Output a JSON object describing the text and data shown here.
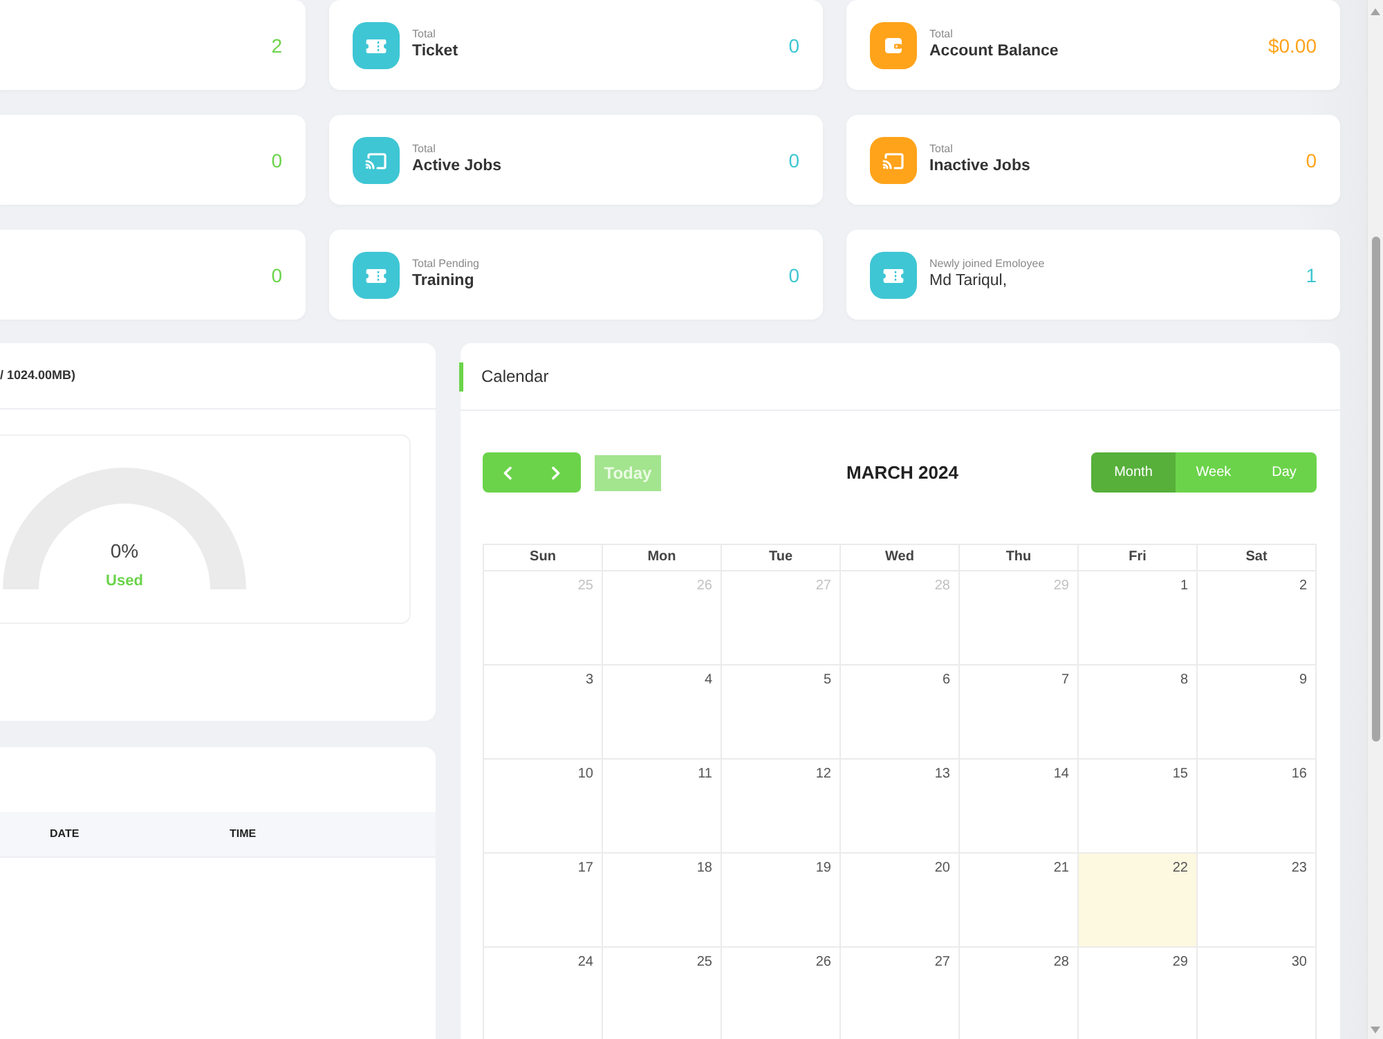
{
  "stats": [
    {
      "value": "2",
      "color": "#6bd34a"
    },
    {
      "kind": "ticket",
      "caption": "Total",
      "label": "Ticket",
      "label_bold": true,
      "value": "0",
      "color": "#3ec6d4"
    },
    {
      "kind": "wallet",
      "caption": "Total",
      "label": "Account Balance",
      "label_bold": true,
      "value": "$0.00",
      "color": "#ffa31a"
    },
    {
      "value": "0",
      "color": "#6bd34a"
    },
    {
      "kind": "cast",
      "caption": "Total",
      "label": "Active Jobs",
      "label_bold": true,
      "value": "0",
      "color": "#3ec6d4"
    },
    {
      "kind": "cast",
      "caption": "Total",
      "label": "Inactive Jobs",
      "label_bold": true,
      "value": "0",
      "color": "#ffa31a"
    },
    {
      "value": "0",
      "color": "#6bd34a"
    },
    {
      "kind": "ticket",
      "caption": "Total Pending",
      "label": "Training",
      "label_bold": true,
      "value": "0",
      "color": "#3ec6d4"
    },
    {
      "kind": "ticket",
      "caption": "Newly joined Emoloyee",
      "label": "Md Tariqul,",
      "label_bold": false,
      "value": "1",
      "color": "#3ec6d4"
    }
  ],
  "storage": {
    "title": "/ 1024.00MB)",
    "gauge": {
      "reading": "0%",
      "label": "Used"
    }
  },
  "history": {
    "columns": [
      "DATE",
      "TIME"
    ]
  },
  "calendar": {
    "title": "Calendar",
    "today_button": {
      "label": "Today",
      "disabled": true
    },
    "heading": "MARCH 2024",
    "views": [
      {
        "label": "Month",
        "selected": true
      },
      {
        "label": "Week",
        "selected": false
      },
      {
        "label": "Day",
        "selected": false
      }
    ],
    "weekdays": [
      "Sun",
      "Mon",
      "Tue",
      "Wed",
      "Thu",
      "Fri",
      "Sat"
    ],
    "weeks": [
      [
        {
          "day": "25",
          "outside": true,
          "today": false
        },
        {
          "day": "26",
          "outside": true,
          "today": false
        },
        {
          "day": "27",
          "outside": true,
          "today": false
        },
        {
          "day": "28",
          "outside": true,
          "today": false
        },
        {
          "day": "29",
          "outside": true,
          "today": false
        },
        {
          "day": "1",
          "outside": false,
          "today": false
        },
        {
          "day": "2",
          "outside": false,
          "today": false
        }
      ],
      [
        {
          "day": "3",
          "outside": false,
          "today": false
        },
        {
          "day": "4",
          "outside": false,
          "today": false
        },
        {
          "day": "5",
          "outside": false,
          "today": false
        },
        {
          "day": "6",
          "outside": false,
          "today": false
        },
        {
          "day": "7",
          "outside": false,
          "today": false
        },
        {
          "day": "8",
          "outside": false,
          "today": false
        },
        {
          "day": "9",
          "outside": false,
          "today": false
        }
      ],
      [
        {
          "day": "10",
          "outside": false,
          "today": false
        },
        {
          "day": "11",
          "outside": false,
          "today": false
        },
        {
          "day": "12",
          "outside": false,
          "today": false
        },
        {
          "day": "13",
          "outside": false,
          "today": false
        },
        {
          "day": "14",
          "outside": false,
          "today": false
        },
        {
          "day": "15",
          "outside": false,
          "today": false
        },
        {
          "day": "16",
          "outside": false,
          "today": false
        }
      ],
      [
        {
          "day": "17",
          "outside": false,
          "today": false
        },
        {
          "day": "18",
          "outside": false,
          "today": false
        },
        {
          "day": "19",
          "outside": false,
          "today": false
        },
        {
          "day": "20",
          "outside": false,
          "today": false
        },
        {
          "day": "21",
          "outside": false,
          "today": false
        },
        {
          "day": "22",
          "outside": false,
          "today": true
        },
        {
          "day": "23",
          "outside": false,
          "today": false
        }
      ],
      [
        {
          "day": "24",
          "outside": false,
          "today": false
        },
        {
          "day": "25",
          "outside": false,
          "today": false
        },
        {
          "day": "26",
          "outside": false,
          "today": false
        },
        {
          "day": "27",
          "outside": false,
          "today": false
        },
        {
          "day": "28",
          "outside": false,
          "today": false
        },
        {
          "day": "29",
          "outside": false,
          "today": false
        },
        {
          "day": "30",
          "outside": false,
          "today": false
        }
      ]
    ]
  }
}
